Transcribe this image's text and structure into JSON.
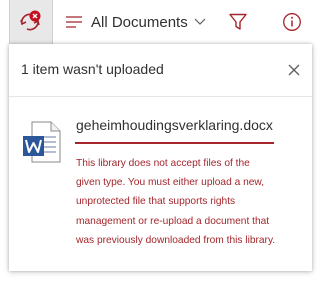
{
  "toolbar": {
    "sync_icon": "sync-error-icon",
    "view_icon": "list-view-icon",
    "view_label": "All Documents",
    "chevron_icon": "chevron-down-icon",
    "filter_icon": "filter-icon",
    "info_icon": "info-icon"
  },
  "panel": {
    "title": "1 item wasn't uploaded",
    "close_icon": "close-icon",
    "file": {
      "icon": "word-document-icon",
      "name": "geheimhoudingsverklaring.docx",
      "error": "This library does not accept files of the given type. You must either upload a new, unprotected file that supports rights management or re-upload a document that was previously downloaded from this library."
    }
  },
  "colors": {
    "accent": "#a4262c",
    "error_badge": "#c50f1f",
    "word_blue": "#2b579a",
    "text": "#323130"
  }
}
